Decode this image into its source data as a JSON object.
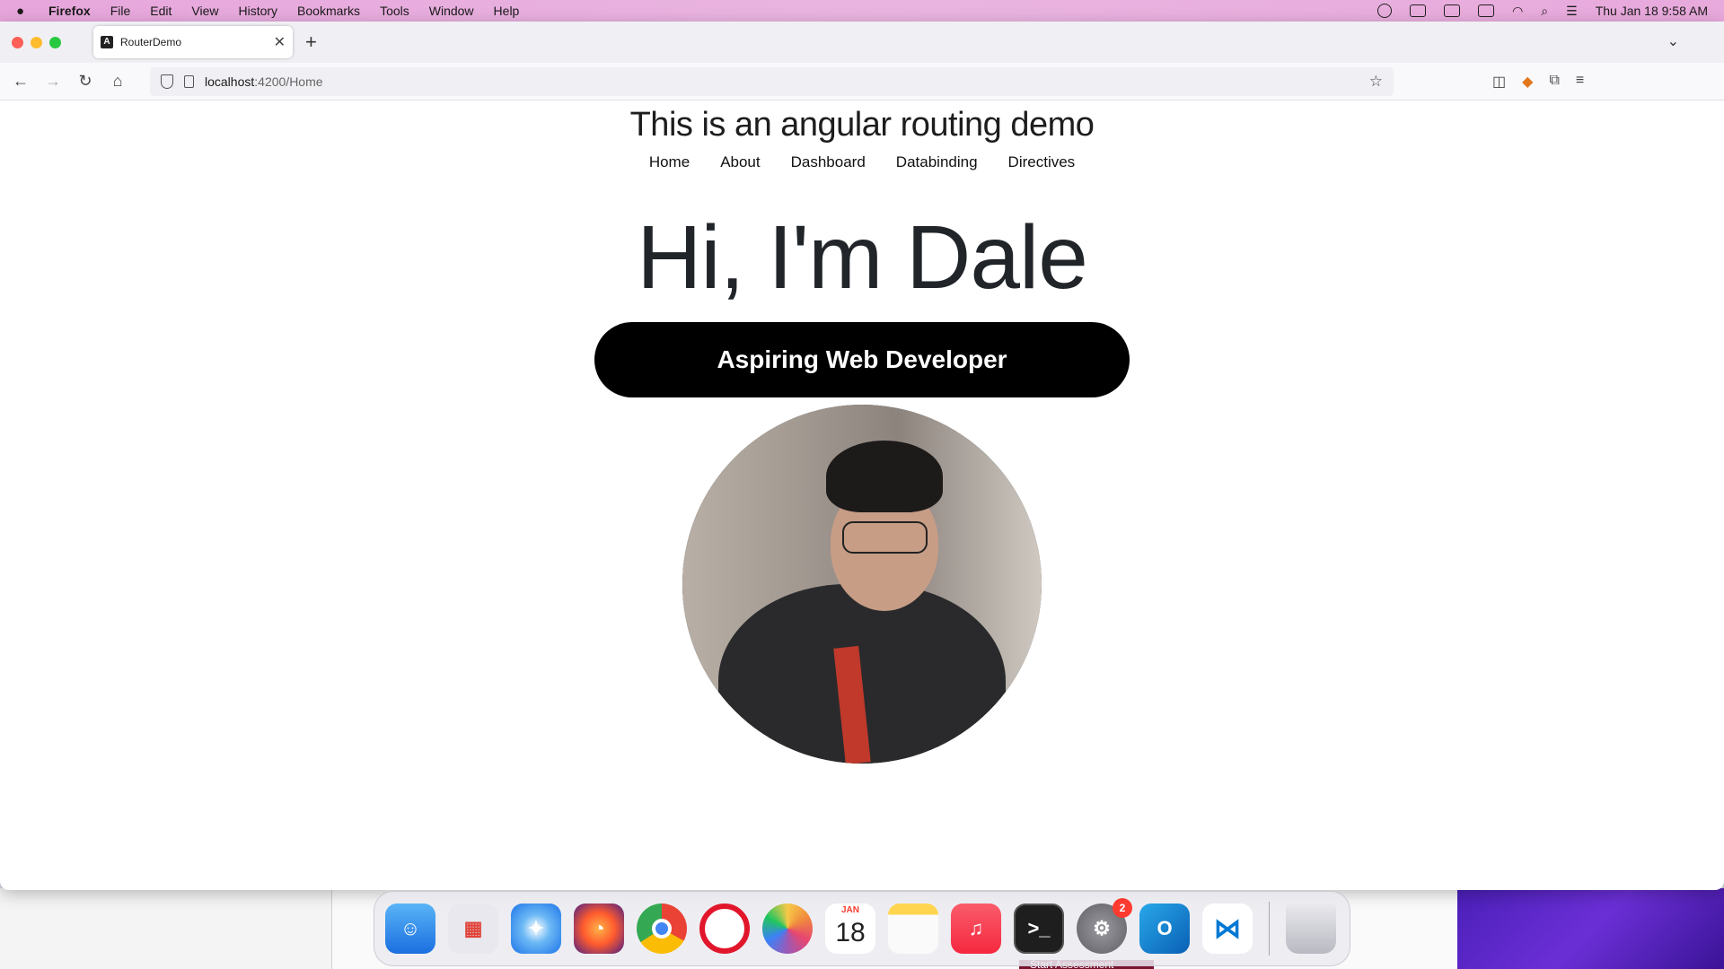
{
  "menubar": {
    "apple": "",
    "app": "Firefox",
    "items": [
      "File",
      "Edit",
      "View",
      "History",
      "Bookmarks",
      "Tools",
      "Window",
      "Help"
    ],
    "clock": "Thu Jan 18  9:58 AM"
  },
  "browser": {
    "tab_title": "RouterDemo",
    "tab_favicon": "angular-icon",
    "url_host": "localhost",
    "url_path": ":4200/Home"
  },
  "page": {
    "heading": "This is an angular routing demo",
    "nav": [
      "Home",
      "About",
      "Dashboard",
      "Databinding",
      "Directives"
    ],
    "hero": "Hi, I'm Dale",
    "tagline": "Aspiring Web Developer"
  },
  "dock": {
    "calendar_month": "JAN",
    "calendar_day": "18",
    "settings_badge": "2",
    "apps": [
      "Finder",
      "Launchpad",
      "Safari",
      "Firefox",
      "Chrome",
      "Opera",
      "Photos",
      "Calendar",
      "Notes",
      "Music",
      "Terminal",
      "System Settings",
      "Outlook",
      "Visual Studio Code",
      "Trash"
    ]
  },
  "desktop": {
    "snippet": "Start Assessment"
  }
}
